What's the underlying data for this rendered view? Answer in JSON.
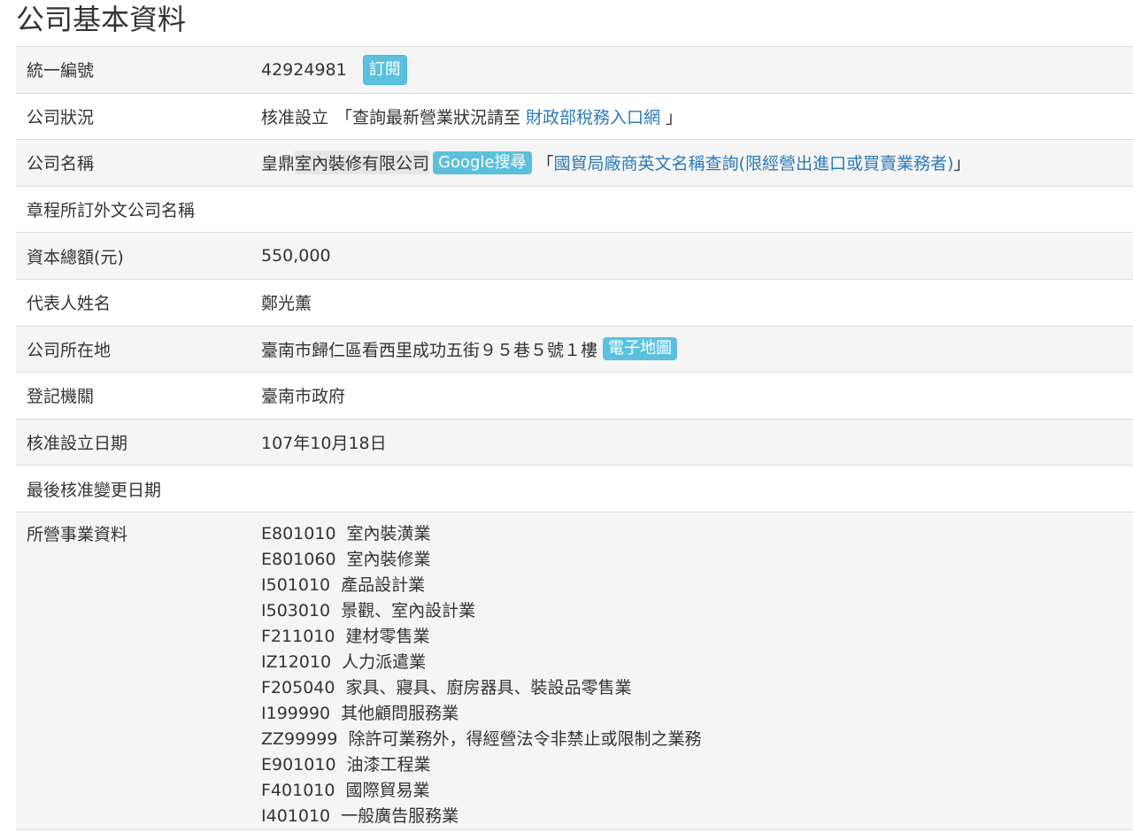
{
  "page_title": "公司基本資料",
  "rows": {
    "ban": {
      "label": "統一編號",
      "value": "42924981",
      "subscribe_label": "訂閱"
    },
    "status": {
      "label": "公司狀況",
      "value": "核准設立",
      "query_prefix": "「查詢最新營業狀況請至",
      "link_text": "財政部稅務入口網",
      "query_suffix": "」"
    },
    "name": {
      "label": "公司名稱",
      "value_prefix": "皇鼎",
      "value_highlight": "室內裝修有限公司",
      "google_label": "Google搜尋",
      "bracket_open": "「",
      "trade_link": "國貿局廠商英文名稱查詢(限經營出進口或買賣業務者)",
      "bracket_close": "」"
    },
    "foreign_name": {
      "label": "章程所訂外文公司名稱",
      "value": ""
    },
    "capital": {
      "label": "資本總額(元)",
      "value": "550,000"
    },
    "representative": {
      "label": "代表人姓名",
      "value": "鄭光薰"
    },
    "address": {
      "label": "公司所在地",
      "value": "臺南市歸仁區看西里成功五街９５巷５號１樓",
      "map_label": "電子地圖"
    },
    "authority": {
      "label": "登記機關",
      "value": "臺南市政府"
    },
    "approval_date": {
      "label": "核准設立日期",
      "value": "107年10月18日"
    },
    "last_change": {
      "label": "最後核准變更日期",
      "value": ""
    },
    "business": {
      "label": "所營事業資料",
      "items": [
        {
          "code": "E801010",
          "desc": "室內裝潢業"
        },
        {
          "code": "E801060",
          "desc": "室內裝修業"
        },
        {
          "code": "I501010",
          "desc": "產品設計業"
        },
        {
          "code": "I503010",
          "desc": "景觀、室內設計業"
        },
        {
          "code": "F211010",
          "desc": "建材零售業"
        },
        {
          "code": "IZ12010",
          "desc": "人力派遣業"
        },
        {
          "code": "F205040",
          "desc": "家具、寢具、廚房器具、裝設品零售業"
        },
        {
          "code": "I199990",
          "desc": "其他顧問服務業"
        },
        {
          "code": "ZZ99999",
          "desc": "除許可業務外，得經營法令非禁止或限制之業務"
        },
        {
          "code": "E901010",
          "desc": "油漆工程業"
        },
        {
          "code": "F401010",
          "desc": "國際貿易業"
        },
        {
          "code": "I401010",
          "desc": "一般廣告服務業"
        }
      ]
    }
  }
}
